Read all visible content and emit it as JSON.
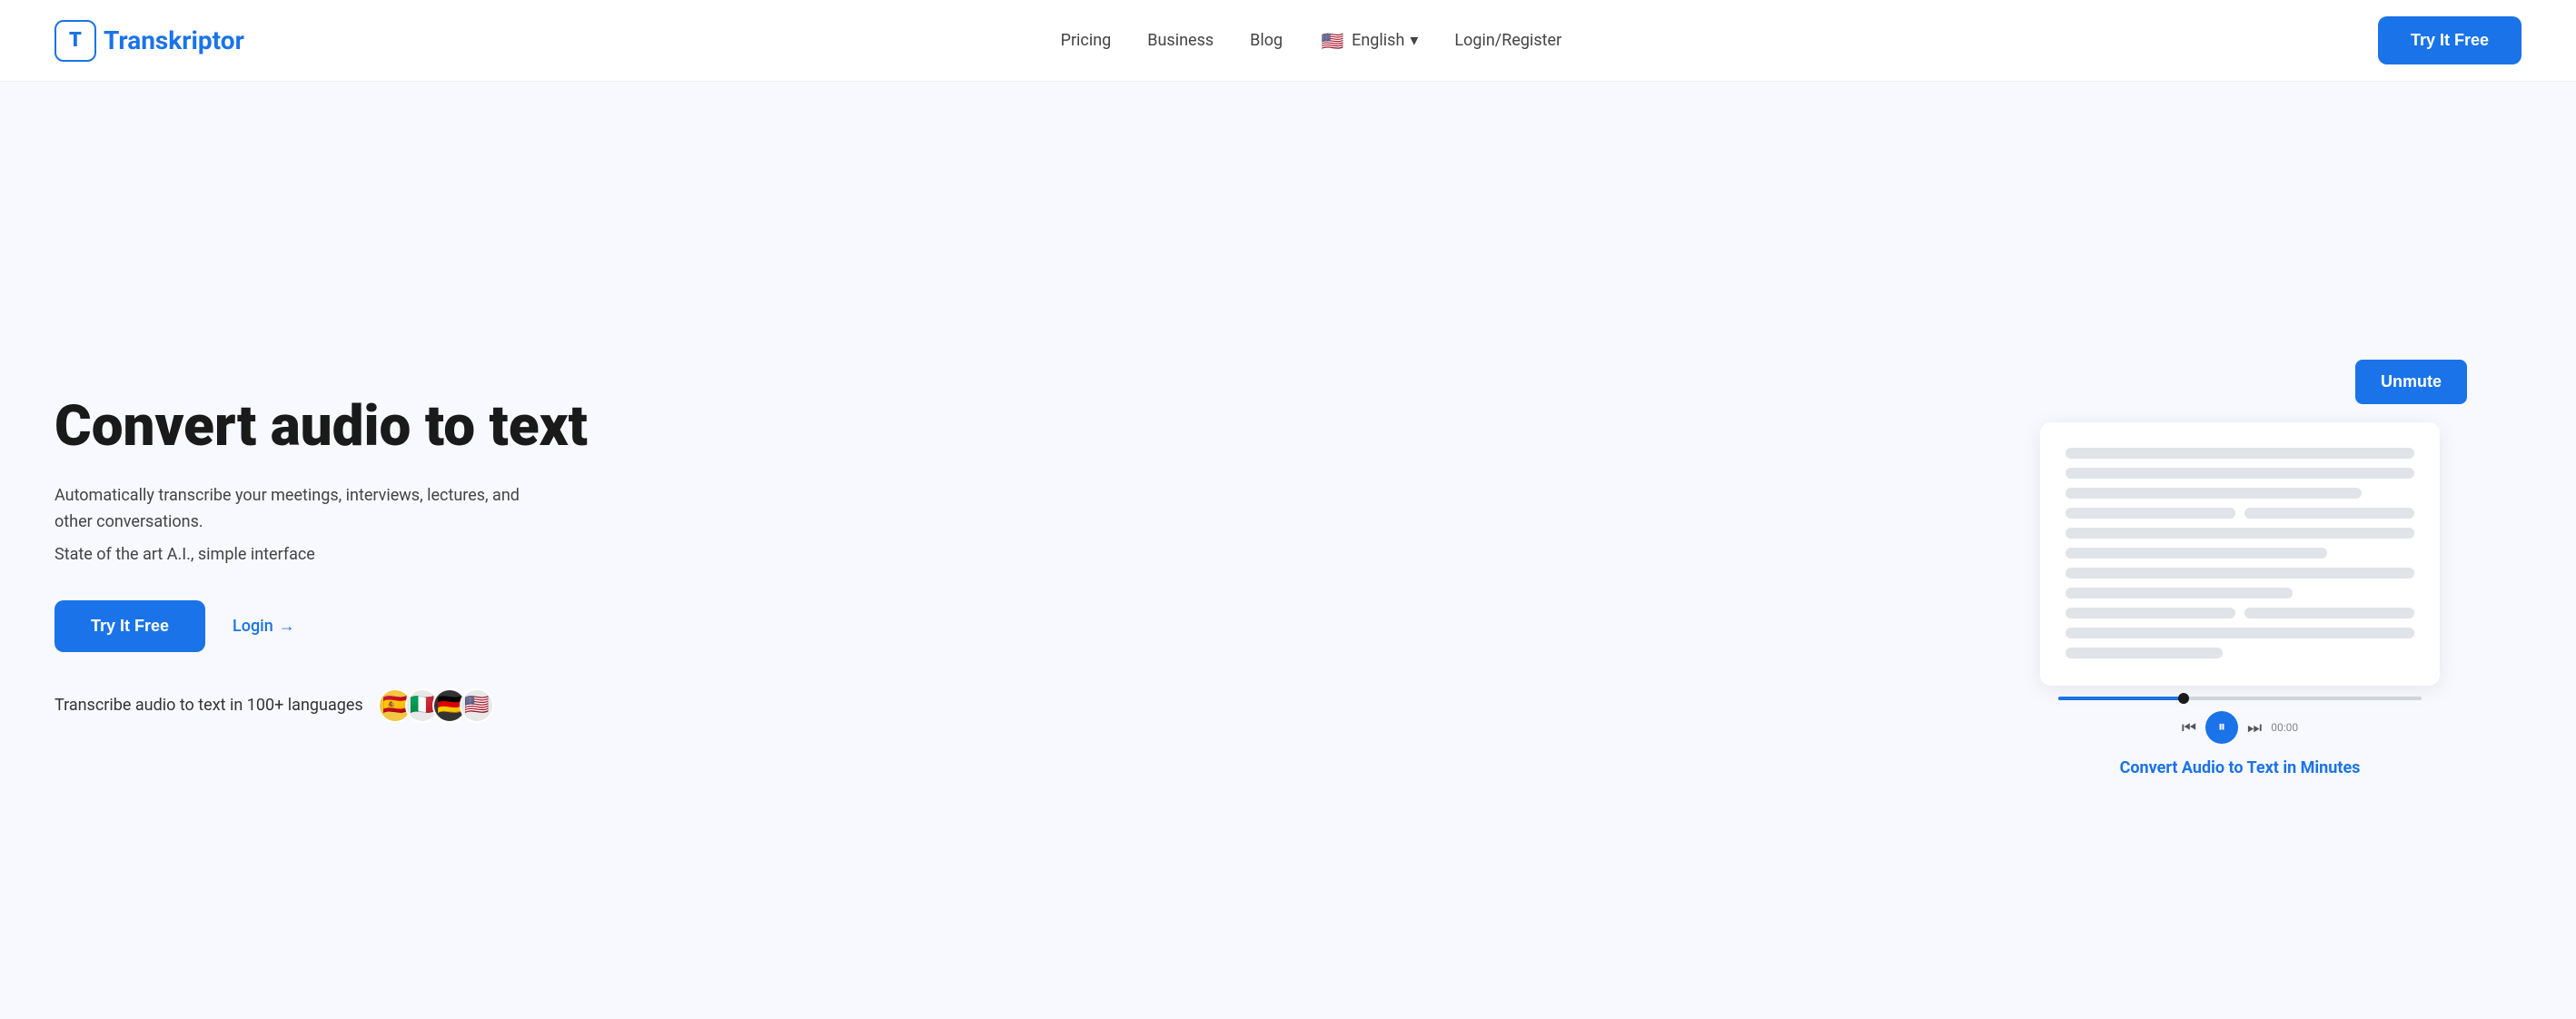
{
  "brand": {
    "logo_letter": "T",
    "logo_name_blue": "Transkriptor",
    "logo_name_parts": {
      "blue": "T",
      "dark": "ranskriptor"
    }
  },
  "navbar": {
    "pricing_label": "Pricing",
    "business_label": "Business",
    "blog_label": "Blog",
    "language_label": "English",
    "login_register_label": "Login/Register",
    "try_btn_label": "Try It Free",
    "flag_emoji": "🇺🇸"
  },
  "hero": {
    "title": "Convert audio to text",
    "subtitle1": "Automatically transcribe your meetings, interviews, lectures, and other conversations.",
    "subtitle2": "State of the art A.I., simple interface",
    "try_btn_label": "Try It Free",
    "login_label": "Login",
    "login_arrow": "→",
    "languages_text": "Transcribe audio to text in 100+ languages",
    "flags": [
      "🇪🇸",
      "🇮🇹",
      "🇩🇪",
      "🇺🇸"
    ],
    "unmute_label": "Unmute",
    "convert_caption": "Convert Audio to Text in Minutes",
    "time_display": "00:00",
    "transcript_lines": [
      {
        "width": "full"
      },
      {
        "width": "full"
      },
      {
        "width": "90"
      },
      {
        "width": "full"
      },
      {
        "width": "80"
      },
      {
        "width": "full"
      },
      {
        "width": "70"
      },
      {
        "width": "full"
      },
      {
        "width": "60"
      },
      {
        "width": "50"
      },
      {
        "width": "full"
      },
      {
        "width": "40"
      }
    ]
  },
  "icons": {
    "back_skip": "⏮",
    "forward_skip": "⏭",
    "play_pause": "⏸",
    "chevron_down": "▾"
  }
}
